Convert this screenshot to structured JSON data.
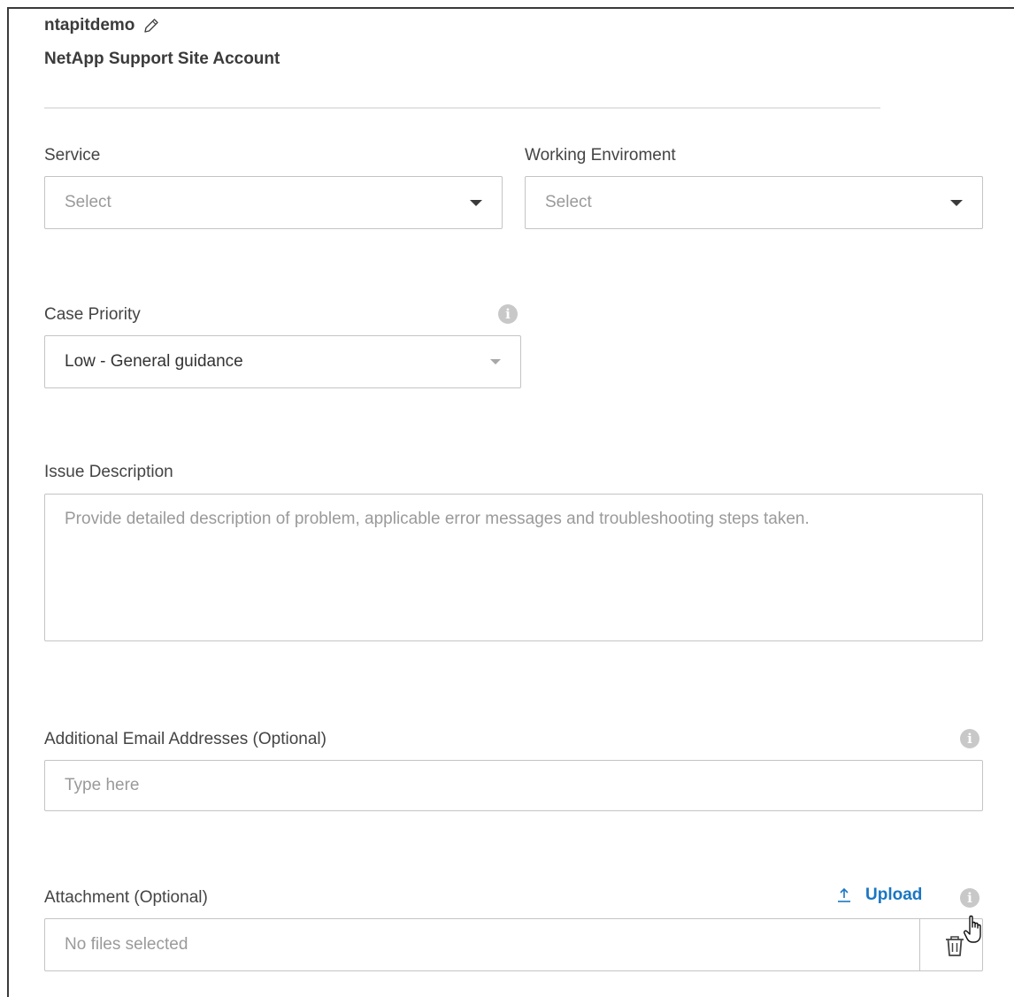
{
  "account": {
    "name": "ntapitdemo",
    "type": "NetApp Support Site Account"
  },
  "service": {
    "label": "Service",
    "placeholder": "Select"
  },
  "working_environment": {
    "label": "Working Enviroment",
    "placeholder": "Select"
  },
  "case_priority": {
    "label": "Case Priority",
    "value": "Low - General guidance"
  },
  "issue_description": {
    "label": "Issue Description",
    "placeholder": "Provide detailed description of problem, applicable error messages and troubleshooting steps taken."
  },
  "additional_emails": {
    "label": "Additional Email Addresses (Optional)",
    "placeholder": "Type here"
  },
  "attachment": {
    "label": "Attachment (Optional)",
    "upload_label": "Upload",
    "status": "No files selected"
  },
  "icons": {
    "edit": "pencil-icon",
    "info": "info-icon",
    "upload": "upload-icon",
    "delete": "trash-icon",
    "cursor": "hand-pointer-cursor"
  },
  "colors": {
    "link_blue": "#1a76c2",
    "border": "#c4c4c4",
    "placeholder": "#9a9a9a",
    "info_icon": "#c8c8c8"
  }
}
